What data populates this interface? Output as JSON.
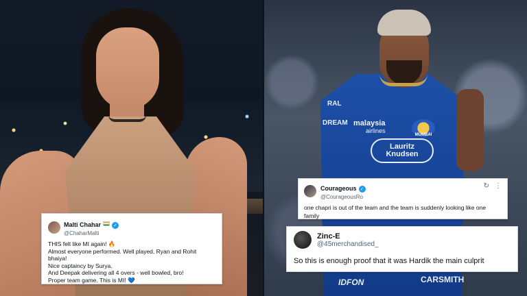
{
  "images": {
    "left_photo_label": "woman-on-balcony-photo",
    "right_photo_label": "cricketer-in-mi-jersey-photo"
  },
  "jersey": {
    "sponsor_top": "malaysia",
    "sponsor_top2": "airlines",
    "sponsor_badge_line1": "Lauritz",
    "sponsor_badge_line2": "Knudsen",
    "mi_logo_text": "MUMBAI",
    "chest_text": "RAL",
    "dream_text": "DREAM",
    "bottom_left": "IDFON",
    "bottom_right": "CARSMITH"
  },
  "tweets": [
    {
      "name": "Malti Chahar",
      "handle": "@ChaharMalti",
      "lines": [
        "THIS felt like MI again! 🔥",
        "Almost everyone performed. Well played, Ryan and Rohit bhaiya!",
        "Nice captaincy by Surya.",
        "And Deepak delivering all 4 overs - well bowled, bro!",
        "Proper team game. This is MI! 💙"
      ]
    },
    {
      "name": "Courageous",
      "handle": "@CourageousRo",
      "lines": [
        "one chapri is out of the team and the team is suddenly looking like one",
        "family"
      ]
    },
    {
      "name": "Zinc-E",
      "handle": "@45merchandised_",
      "lines": [
        "So this is enough proof that it was Hardik the main culprit"
      ]
    }
  ],
  "icons": {
    "verified": "✓",
    "refresh": "↻",
    "more": "⋮"
  },
  "colors": {
    "verified_blue": "#1d9bf0",
    "jersey_blue": "#1d4fa8"
  }
}
